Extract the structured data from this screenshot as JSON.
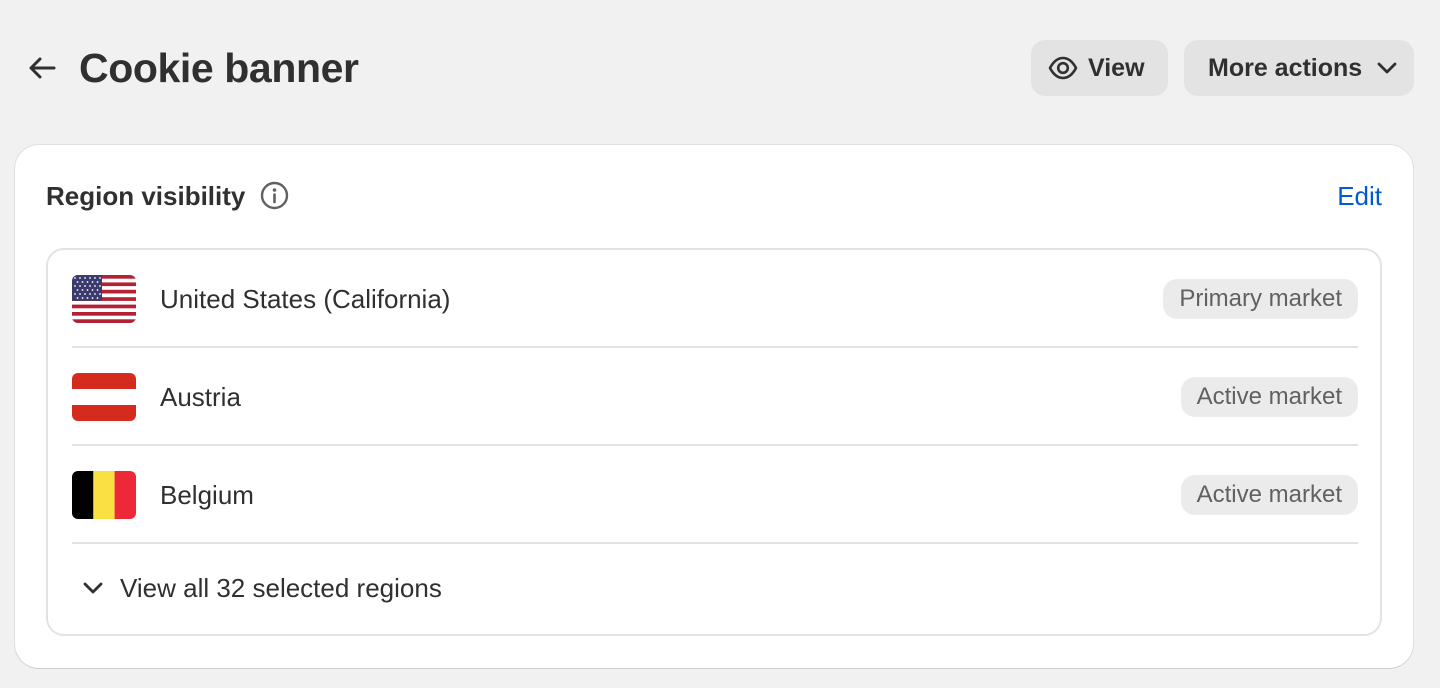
{
  "header": {
    "title": "Cookie banner",
    "view_label": "View",
    "more_actions_label": "More actions"
  },
  "card": {
    "title": "Region visibility",
    "edit_label": "Edit",
    "regions": [
      {
        "name": "United States (California)",
        "badge": "Primary market",
        "flag": "us-flag"
      },
      {
        "name": "Austria",
        "badge": "Active market",
        "flag": "austria-flag"
      },
      {
        "name": "Belgium",
        "badge": "Active market",
        "flag": "belgium-flag"
      }
    ],
    "view_all_label": "View all 32 selected regions"
  },
  "colors": {
    "background": "#f1f1f1",
    "card": "#ffffff",
    "button": "#e3e3e3",
    "link": "#005bd3",
    "text": "#303030",
    "badge_bg": "#ebebeb",
    "badge_text": "#616161"
  },
  "icons": [
    "arrow-left-icon",
    "eye-icon",
    "chevron-down-icon",
    "info-icon"
  ]
}
